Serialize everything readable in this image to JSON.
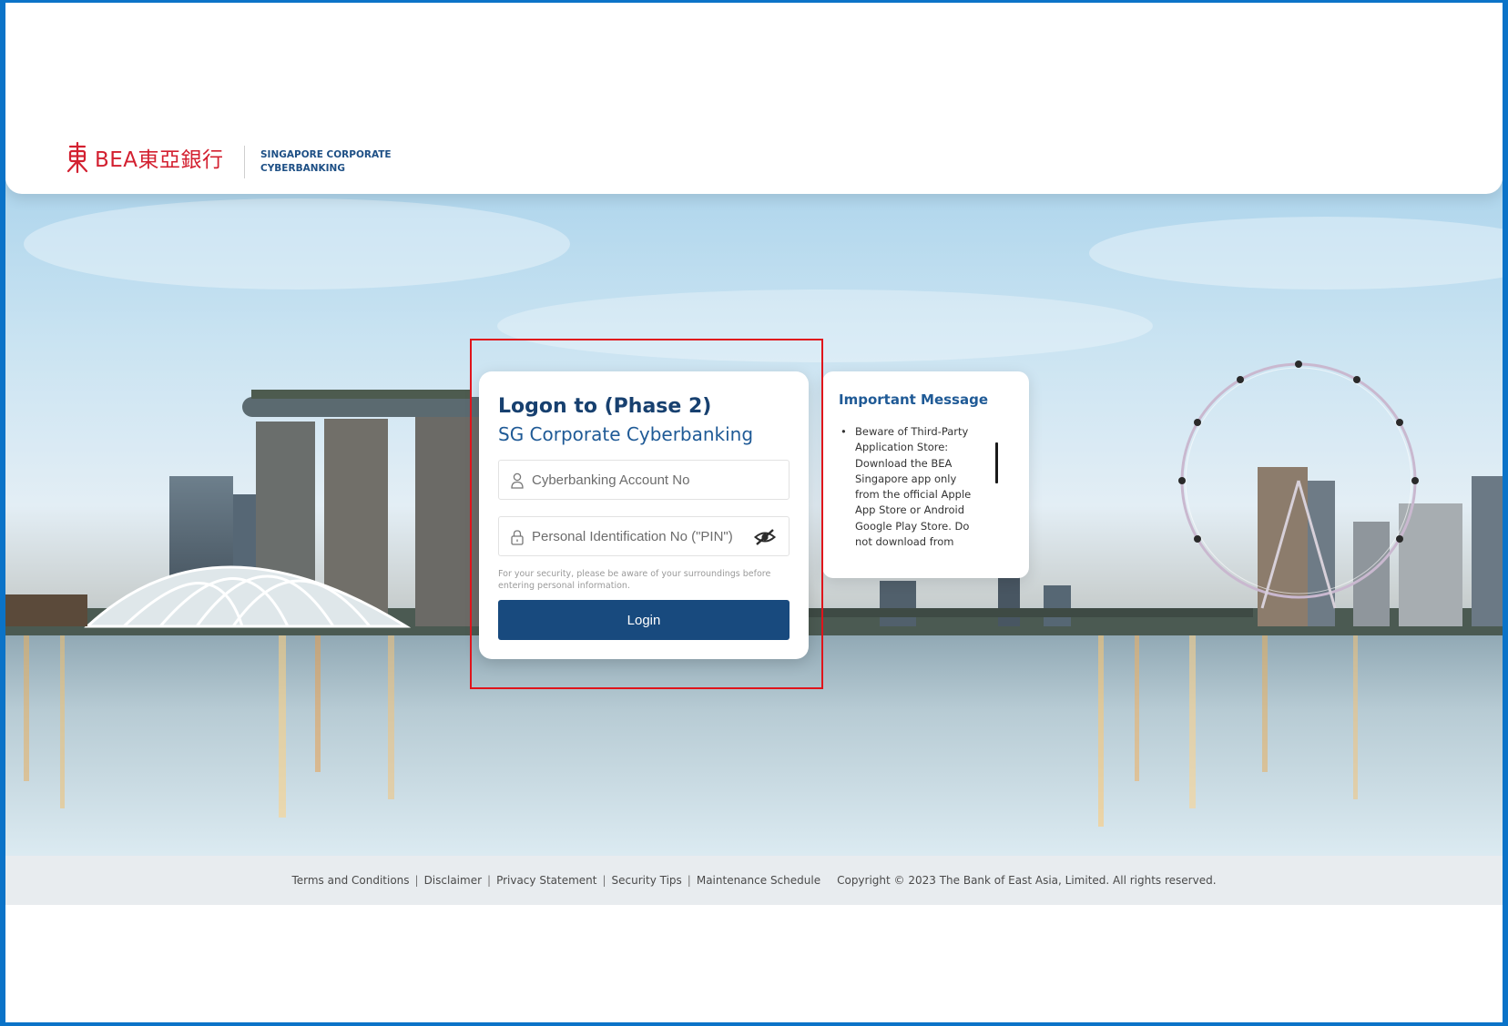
{
  "header": {
    "logo_text": "BEA東亞銀行",
    "subtitle_line1": "SINGAPORE CORPORATE",
    "subtitle_line2": "CYBERBANKING"
  },
  "login": {
    "title": "Logon to (Phase 2)",
    "subtitle": "SG Corporate Cyberbanking",
    "account_placeholder": "Cyberbanking Account No",
    "pin_placeholder": "Personal Identification No (\"PIN\")",
    "security_note": "For your security, please be aware of your surroundings before entering personal information.",
    "login_label": "Login",
    "icons": {
      "account": "user-icon",
      "pin": "lock-icon",
      "toggle": "eye-slash-icon"
    }
  },
  "message": {
    "title": "Important Message",
    "items": [
      "Beware of Third-Party Application Store: Download the BEA Singapore app only from the official Apple App Store or Android Google Play Store. Do not download from"
    ]
  },
  "footer": {
    "links": [
      "Terms and Conditions",
      "Disclaimer",
      "Privacy Statement",
      "Security Tips",
      "Maintenance Schedule"
    ],
    "copyright": "Copyright © 2023 The Bank of East Asia, Limited. All rights reserved."
  },
  "colors": {
    "brand_red": "#d32030",
    "primary_navy": "#184a7e",
    "title_blue": "#17406f",
    "frame_blue": "#0b73c8",
    "highlight_red": "#e0141b"
  }
}
